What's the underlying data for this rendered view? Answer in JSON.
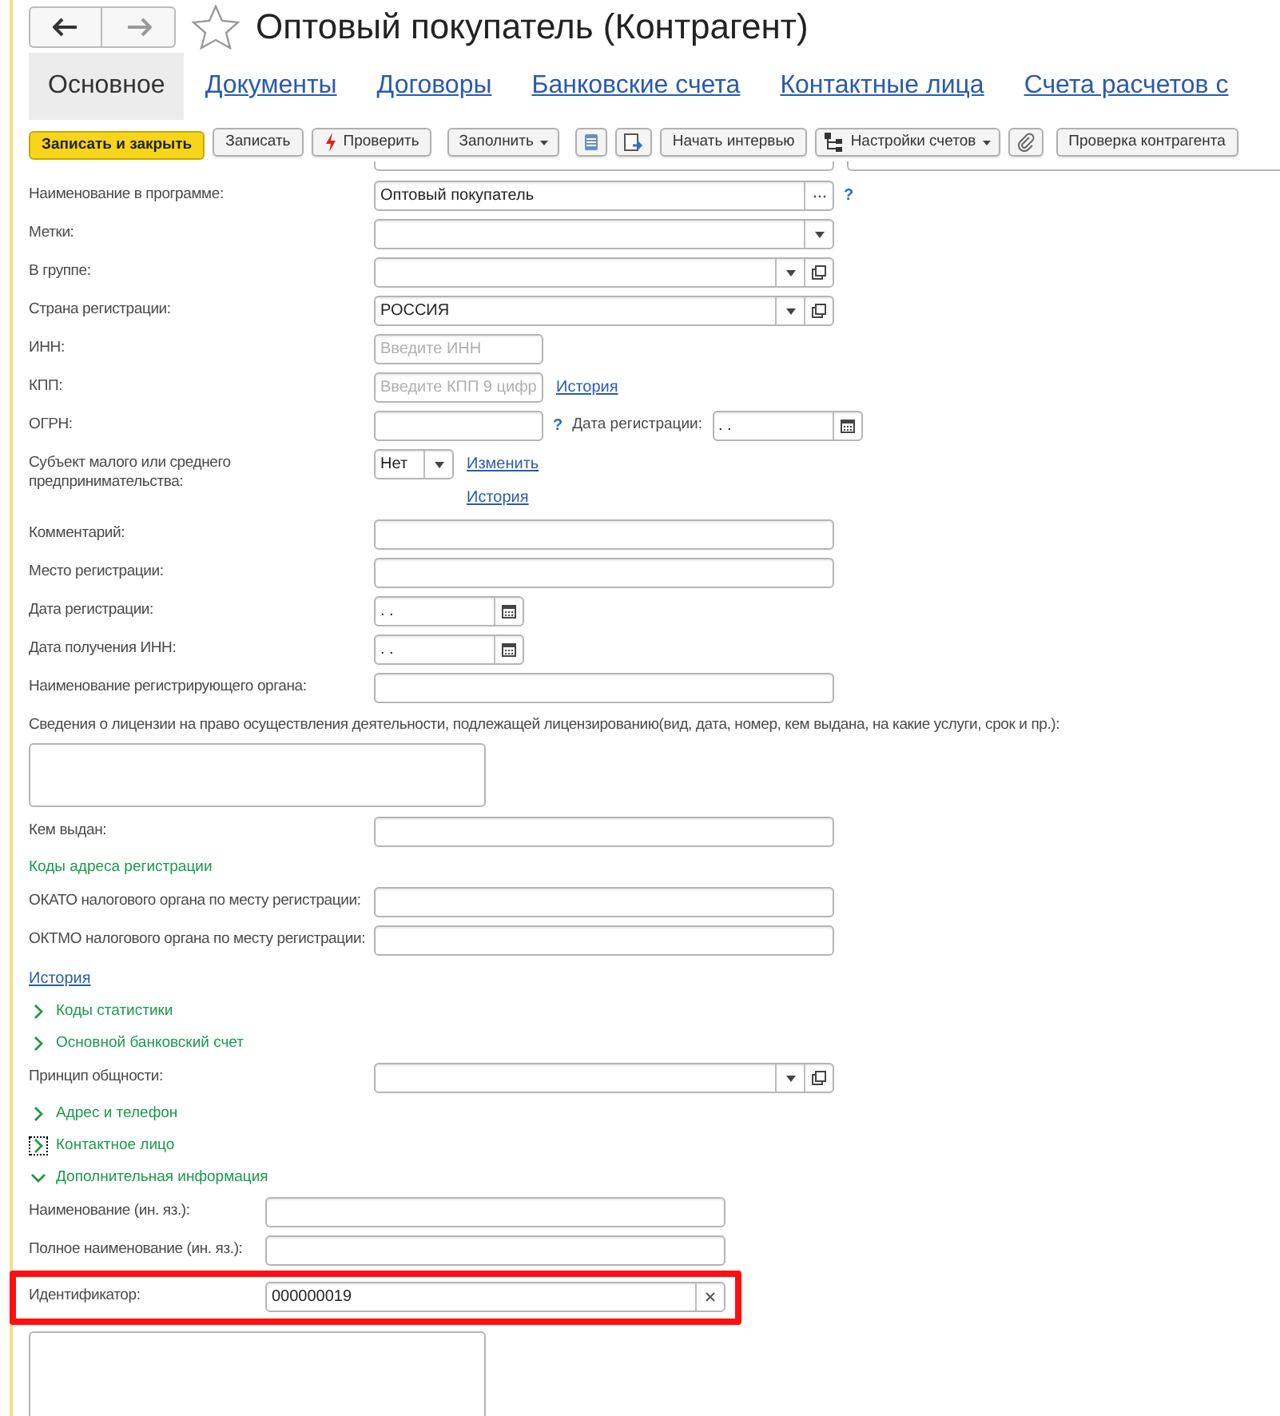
{
  "window": {
    "title": "Оптовый покупатель (Контрагент)",
    "favorite": false
  },
  "tabs": [
    {
      "label": "Основное",
      "selected": true
    },
    {
      "label": "Документы",
      "selected": false
    },
    {
      "label": "Договоры",
      "selected": false
    },
    {
      "label": "Банковские счета",
      "selected": false
    },
    {
      "label": "Контактные лица",
      "selected": false
    },
    {
      "label": "Счета расчетов с",
      "selected": false
    }
  ],
  "toolbar": [
    {
      "kind": "primary",
      "label": "Записать и закрыть"
    },
    {
      "kind": "button",
      "label": "Записать"
    },
    {
      "kind": "check",
      "label": "Проверить"
    },
    {
      "kind": "menu",
      "label": "Заполнить"
    },
    {
      "kind": "list"
    },
    {
      "kind": "report"
    },
    {
      "kind": "button",
      "label": "Начать интервью"
    },
    {
      "kind": "accounts",
      "label": "Настройки счетов"
    },
    {
      "kind": "attach"
    },
    {
      "kind": "button",
      "label": "Проверка контрагента"
    }
  ],
  "rows": [
    {
      "kind": "choice",
      "label": "Наименование в программе:",
      "value": "Оптовый покупатель",
      "after": [
        {
          "kind": "help",
          "text": "?"
        }
      ]
    },
    {
      "kind": "select",
      "label": "Метки:"
    },
    {
      "kind": "reference",
      "label": "В группе:"
    },
    {
      "kind": "reference",
      "label": "Страна регистрации:",
      "value": "РОССИЯ"
    },
    {
      "kind": "short",
      "label": "ИНН:",
      "placeholder": "Введите ИНН"
    },
    {
      "kind": "short",
      "label": "КПП:",
      "placeholder": "Введите КПП 9 цифр",
      "after": [
        {
          "kind": "link",
          "text": "История"
        }
      ]
    },
    {
      "kind": "short",
      "label": "ОГРН:",
      "after": [
        {
          "kind": "help",
          "text": "?"
        },
        {
          "kind": "label",
          "text": "Дата регистрации:"
        },
        {
          "kind": "date",
          "value": ".  ."
        }
      ]
    },
    {
      "kind": "flag",
      "label": "Субъект малого или среднего предпринимательства:",
      "value": "Нет",
      "links": [
        "Изменить",
        "История"
      ]
    },
    {
      "kind": "text",
      "label": "Комментарий:"
    },
    {
      "kind": "text",
      "label": "Место регистрации:"
    },
    {
      "kind": "date",
      "label": "Дата регистрации:",
      "value": ".  ."
    },
    {
      "kind": "date",
      "label": "Дата получения ИНН:",
      "value": ".  ."
    },
    {
      "kind": "text",
      "label": "Наименование регистрирующего органа:"
    },
    {
      "kind": "memo",
      "label": "Сведения о лицензии на право осуществления деятельности, подлежащей лицензированию(вид, дата, номер, кем выдана, на какие услуги, срок и пр.):"
    },
    {
      "kind": "text",
      "label": "Кем выдан:"
    },
    {
      "kind": "heading",
      "label": "Коды адреса регистрации"
    },
    {
      "kind": "text",
      "label": "ОКАТО налогового органа по месту регистрации:"
    },
    {
      "kind": "text",
      "label": "ОКТМО налогового органа по месту регистрации:"
    },
    {
      "kind": "link",
      "label": "История"
    },
    {
      "kind": "group",
      "label": "Коды статистики",
      "expanded": false,
      "focused": false
    },
    {
      "kind": "group",
      "label": "Основной банковский счет",
      "expanded": false,
      "focused": false
    },
    {
      "kind": "reference",
      "label": "Принцип общности:"
    },
    {
      "kind": "group",
      "label": "Адрес и телефон",
      "expanded": false,
      "focused": false
    },
    {
      "kind": "group",
      "label": "Контактное лицо",
      "expanded": false,
      "focused": true
    },
    {
      "kind": "group",
      "label": "Дополнительная информация",
      "expanded": true,
      "focused": false,
      "children": [
        {
          "kind": "text",
          "label": "Наименование (ин. яз.):"
        },
        {
          "kind": "text",
          "label": "Полное наименование (ин. яз.):"
        },
        {
          "kind": "clearable",
          "label": "Идентификатор:",
          "value": "000000019",
          "highlighted": true
        }
      ]
    }
  ]
}
